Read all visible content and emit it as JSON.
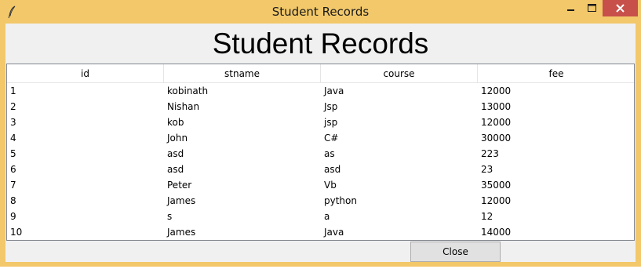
{
  "window": {
    "title": "Student Records",
    "accent": "#f2c86a",
    "close_color": "#c7504a",
    "icons": {
      "app": "feather-icon",
      "minimize": "minimize-icon",
      "maximize": "maximize-icon",
      "close": "close-icon"
    }
  },
  "heading": "Student Records",
  "table": {
    "columns": [
      "id",
      "stname",
      "course",
      "fee"
    ],
    "rows": [
      [
        "1",
        "kobinath",
        "Java",
        "12000"
      ],
      [
        "2",
        "Nishan",
        "Jsp",
        "13000"
      ],
      [
        "3",
        "kob",
        "jsp",
        "12000"
      ],
      [
        "4",
        "John",
        "C#",
        "30000"
      ],
      [
        "5",
        "asd",
        "as",
        "223"
      ],
      [
        "6",
        "asd",
        "asd",
        "23"
      ],
      [
        "7",
        "Peter",
        "Vb",
        "35000"
      ],
      [
        "8",
        "James",
        "python",
        "12000"
      ],
      [
        "9",
        "s",
        "a",
        "12"
      ],
      [
        "10",
        "James",
        "Java",
        "14000"
      ]
    ]
  },
  "buttons": {
    "close_label": "Close"
  }
}
